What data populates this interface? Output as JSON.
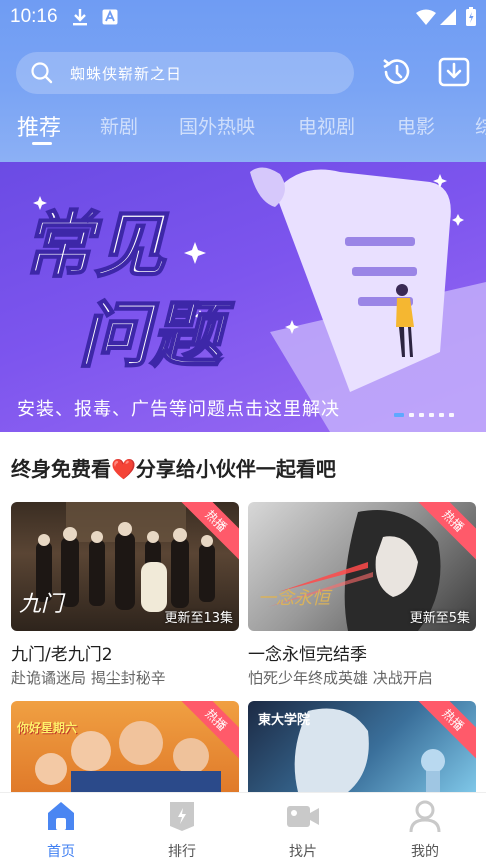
{
  "status_bar": {
    "time": "10:16"
  },
  "search": {
    "placeholder": "蜘蛛侠崭新之日"
  },
  "tabs": [
    "推荐",
    "新剧",
    "国外热映",
    "电视剧",
    "电影",
    "综"
  ],
  "banner": {
    "headline_line1": "常见",
    "headline_line2": "问题",
    "caption": "安装、报毒、广告等问题点击这里解决"
  },
  "section": {
    "title": "终身免费看❤️分享给小伙伴一起看吧"
  },
  "cards": [
    {
      "badge": "热播",
      "episode": "更新至13集",
      "title": "九门/老九门2",
      "subtitle": "赴诡谲迷局 揭尘封秘辛",
      "poster_text": "九门"
    },
    {
      "badge": "热播",
      "episode": "更新至5集",
      "title": "一念永恒完结季",
      "subtitle": "怕死少年终成英雄 决战开启",
      "poster_text": "一念永恒"
    },
    {
      "badge": "热播",
      "poster_text": "你好星期六"
    },
    {
      "badge": "热播",
      "poster_text": "東大学院"
    }
  ],
  "bottom_nav": [
    {
      "label": "首页",
      "icon": "home-icon",
      "active": true
    },
    {
      "label": "排行",
      "icon": "ranking-icon",
      "active": false
    },
    {
      "label": "找片",
      "icon": "video-camera-icon",
      "active": false
    },
    {
      "label": "我的",
      "icon": "user-icon",
      "active": false
    }
  ],
  "colors": {
    "header": "#7aa4f4",
    "accent": "#3f7ff2",
    "hot_badge": "#ff5a6a",
    "banner": "#7d55ee"
  }
}
